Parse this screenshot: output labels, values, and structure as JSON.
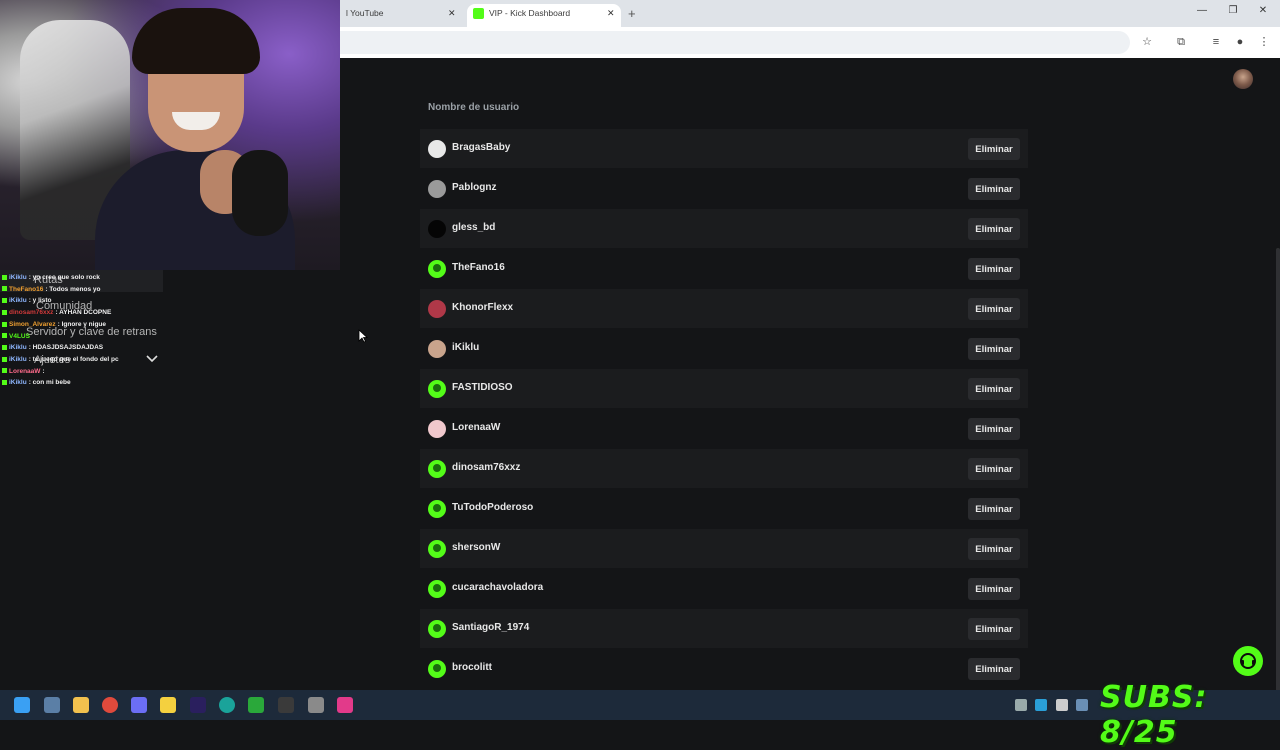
{
  "browser": {
    "tabs": [
      {
        "title": "l YouTube"
      },
      {
        "title": "VIP - Kick Dashboard"
      }
    ]
  },
  "vip_list": {
    "column_header": "Nombre de usuario",
    "delete_label": "Eliminar",
    "users": [
      {
        "name": "BragasBaby",
        "avatar": "photo"
      },
      {
        "name": "Pablognz",
        "avatar": "photo"
      },
      {
        "name": "gless_bd",
        "avatar": "photo"
      },
      {
        "name": "TheFano16",
        "avatar": "default"
      },
      {
        "name": "KhonorFlexx",
        "avatar": "photo"
      },
      {
        "name": "iKiklu",
        "avatar": "photo"
      },
      {
        "name": "FASTIDIOSO",
        "avatar": "default"
      },
      {
        "name": "LorenaaW",
        "avatar": "photo"
      },
      {
        "name": "dinosam76xxz",
        "avatar": "default"
      },
      {
        "name": "TuTodoPoderoso",
        "avatar": "default"
      },
      {
        "name": "shersonW",
        "avatar": "default"
      },
      {
        "name": "cucarachavoladora",
        "avatar": "default"
      },
      {
        "name": "SantiagoR_1974",
        "avatar": "default"
      },
      {
        "name": "brocolitt",
        "avatar": "default"
      }
    ]
  },
  "chat": {
    "messages": [
      {
        "user": "iKiklu",
        "text": ": yo creo que solo rock",
        "color": "#8fb7ff"
      },
      {
        "user": "TheFano16",
        "text": ": Todos menos yo",
        "color": "#f0a030"
      },
      {
        "user": "iKiklu",
        "text": ": y listo",
        "color": "#8fb7ff"
      },
      {
        "user": "dinosam76xxz",
        "text": ": AYHAN DCOPNE",
        "color": "#d23a3a"
      },
      {
        "user": "Simon_Alvarez",
        "text": ": Ignore y nigue",
        "color": "#f0a030"
      },
      {
        "user": "V4LUS",
        "text": "",
        "color": "#53fc18"
      },
      {
        "user": "iKiklu",
        "text": ": HDASJDSAJSDAJDAS",
        "color": "#8fb7ff"
      },
      {
        "user": "iKiklu",
        "text": ": te juego que el fondo del pc",
        "color": "#8fb7ff"
      },
      {
        "user": "LorenaaW",
        "text": ":",
        "color": "#ff6b8b"
      },
      {
        "user": "iKiklu",
        "text": ": con mi bebe",
        "color": "#8fb7ff"
      }
    ],
    "menu_ghost": [
      "Rutas",
      "Comunidad",
      "Servidor y clave de retrans",
      "Ajustes"
    ]
  },
  "overlay": {
    "subs_text": "SUBS: 8/25"
  },
  "colors": {
    "kick_green": "#53fc18",
    "page_bg": "#141517",
    "row_alt": "#1b1c1e"
  }
}
